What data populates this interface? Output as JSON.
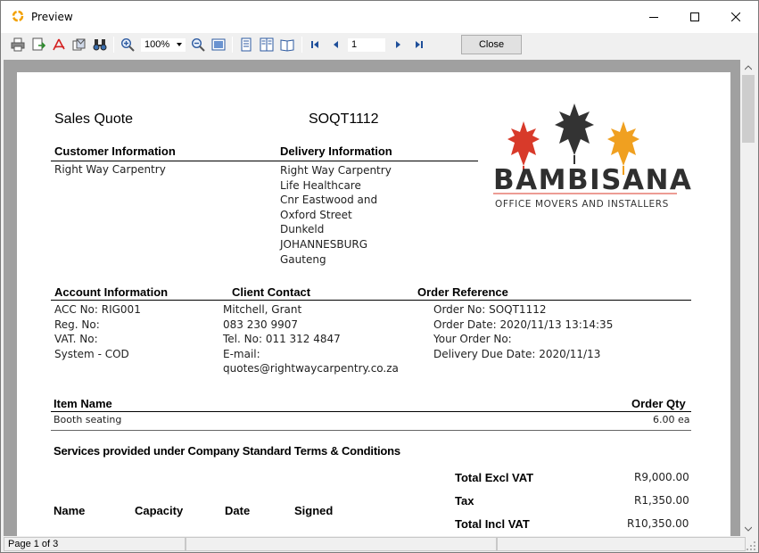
{
  "window": {
    "title": "Preview"
  },
  "toolbar": {
    "zoom": "100%",
    "page_number": "1",
    "close_label": "Close",
    "icons": [
      "print-icon",
      "export-icon",
      "pdf-icon",
      "email-icon",
      "find-icon",
      "zoom-in-icon",
      "zoom-out-icon",
      "page-width-icon",
      "one-page-icon",
      "two-pages-icon",
      "multi-page-icon",
      "first-page-icon",
      "prev-page-icon",
      "next-page-icon",
      "last-page-icon"
    ]
  },
  "document": {
    "title": "Sales Quote",
    "quote_number": "SOQT1112",
    "customer_header": "Customer Information",
    "customer_name": "Right Way Carpentry",
    "delivery_header": "Delivery Information",
    "delivery_lines": [
      "Right Way Carpentry",
      "Life Healthcare",
      "Cnr Eastwood and",
      "Oxford Street",
      "Dunkeld",
      "JOHANNESBURG",
      "Gauteng"
    ],
    "logo": {
      "name": "BAMBISANA",
      "tagline": "OFFICE MOVERS AND INSTALLERS",
      "colors": [
        "#d83a2a",
        "#333333",
        "#f0a020"
      ]
    },
    "account_header": "Account Information",
    "account_lines": [
      "ACC  No:  RIG001",
      "Reg. No:",
      "VAT. No:",
      "System - COD"
    ],
    "contact_header": "Client Contact",
    "contact_lines": [
      "Mitchell, Grant",
      "083 230 9907",
      "Tel.  No: 011 312 4847",
      "E-mail:",
      "quotes@rightwaycarpentry.co.za"
    ],
    "order_header": "Order Reference",
    "order_lines": [
      "Order No: SOQT1112",
      "Order Date: 2020/11/13 13:14:35",
      "Your Order No:",
      "Delivery Due Date: 2020/11/13"
    ],
    "items_header": {
      "name": "Item Name",
      "qty": "Order Qty"
    },
    "items": [
      {
        "name": "Booth seating",
        "qty": "6.00 ea"
      }
    ],
    "terms": "Services provided under Company Standard Terms & Conditions",
    "sign_headers": [
      "Name",
      "Capacity",
      "Date",
      "Signed"
    ],
    "totals": [
      {
        "label": "Total Excl VAT",
        "value": "R9,000.00"
      },
      {
        "label": "Tax",
        "value": "R1,350.00"
      },
      {
        "label": "Total Incl VAT",
        "value": "R10,350.00"
      }
    ]
  },
  "status": {
    "page": "Page 1 of 3"
  }
}
